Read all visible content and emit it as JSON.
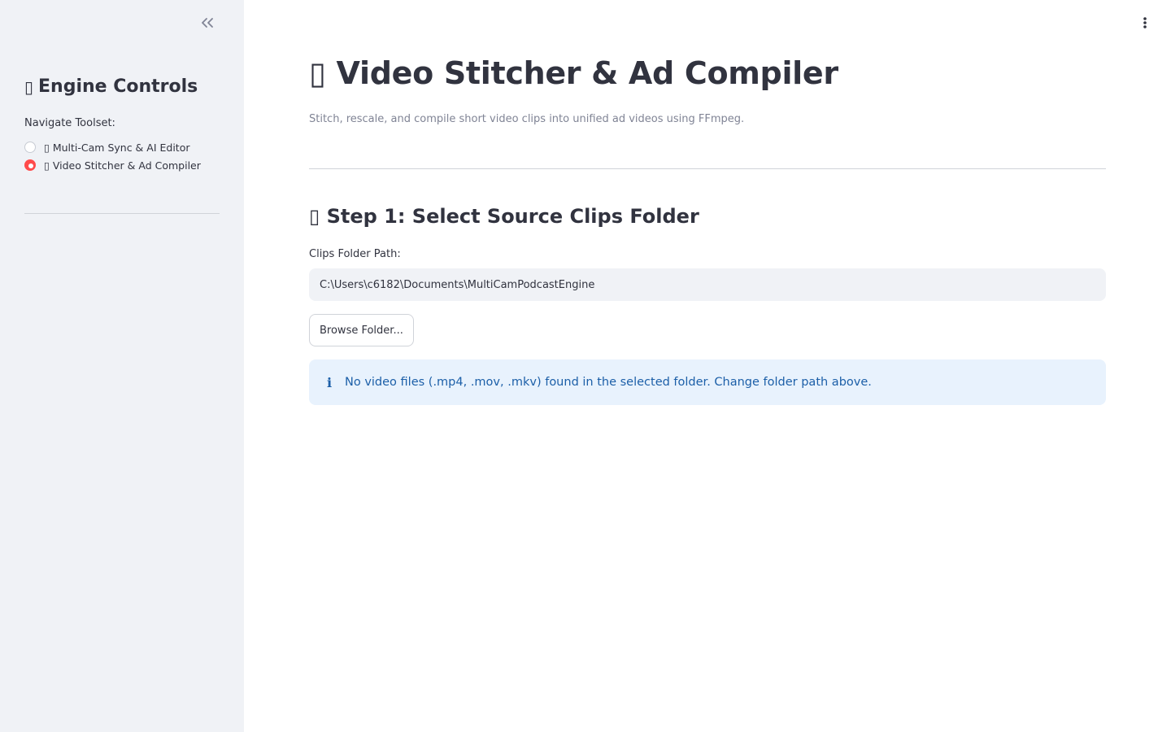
{
  "sidebar": {
    "collapse_icon": "double-chevron-left-icon",
    "title_glyph": "▯",
    "title": "Engine Controls",
    "nav_label": "Navigate Toolset:",
    "options": [
      {
        "label": "▯ Multi-Cam Sync & AI Editor",
        "selected": false
      },
      {
        "label": "▯ Video Stitcher & Ad Compiler",
        "selected": true
      }
    ]
  },
  "header": {
    "menu_icon": "vertical-ellipsis-icon",
    "title": "▯ Video Stitcher & Ad Compiler",
    "subtitle": "Stitch, rescale, and compile short video clips into unified ad videos using FFmpeg."
  },
  "step1": {
    "title": "▯ Step 1: Select Source Clips Folder",
    "field_label": "Clips Folder Path:",
    "folder_path": "C:\\Users\\c6182\\Documents\\MultiCamPodcastEngine",
    "browse_label": "Browse Folder...",
    "info_icon": "info-icon",
    "info_glyph": "i",
    "info_message": "No video files (.mp4, .mov, .mkv) found in the selected folder. Change folder path above."
  },
  "colors": {
    "accent": "#ff4b4b",
    "sidebar_bg": "#f0f2f6",
    "info_bg": "#e8f2fd",
    "info_text": "#1c5fa8",
    "text": "#31333f",
    "muted": "#808495"
  }
}
